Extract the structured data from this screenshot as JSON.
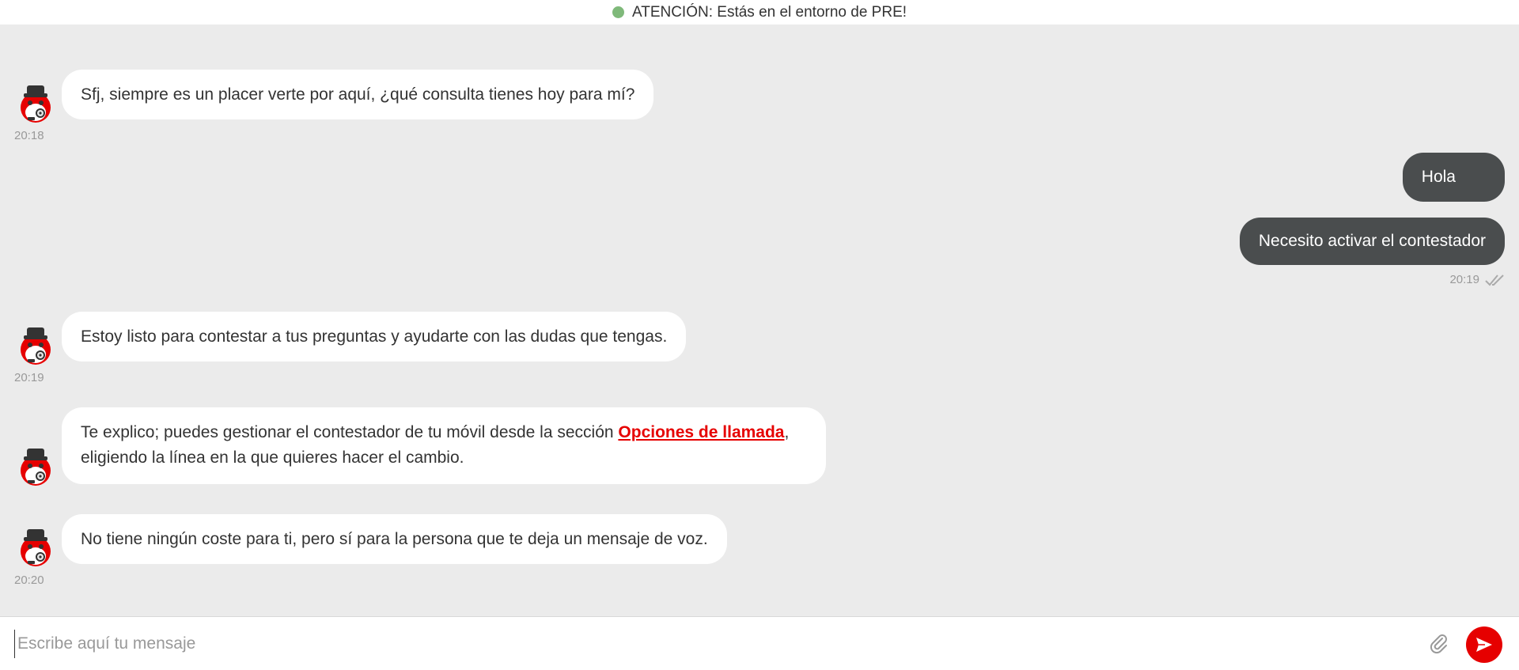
{
  "banner": {
    "text": "ATENCIÓN: Estás en el entorno de PRE!",
    "status_color": "#7fb97a"
  },
  "messages": {
    "bot1": {
      "text": "Sfj, siempre es un placer verte por aquí, ¿qué consulta tienes hoy para mí?",
      "time": "20:18"
    },
    "user1": {
      "text": "Hola"
    },
    "user2": {
      "text": "Necesito activar el contestador",
      "time": "20:19"
    },
    "bot2": {
      "text": "Estoy listo para contestar a tus preguntas y ayudarte con las dudas que tengas.",
      "time": "20:19"
    },
    "bot3": {
      "text_before": "Te explico; puedes gestionar el contestador de tu móvil desde la sección ",
      "link": "Opciones de llamada",
      "text_after": ", eligiendo la línea en la que quieres hacer el cambio."
    },
    "bot4": {
      "text": "No tiene ningún coste para ti, pero sí para la persona que te deja un mensaje de voz.",
      "time": "20:20"
    }
  },
  "composer": {
    "placeholder": "Escribe aquí tu mensaje",
    "value": ""
  },
  "icons": {
    "avatar": "bot-avatar-icon",
    "attach": "paperclip-icon",
    "send": "send-icon",
    "read": "double-check-icon"
  },
  "colors": {
    "accent": "#e60000",
    "user_bubble": "#4a4d4e",
    "background": "#ebebeb"
  }
}
